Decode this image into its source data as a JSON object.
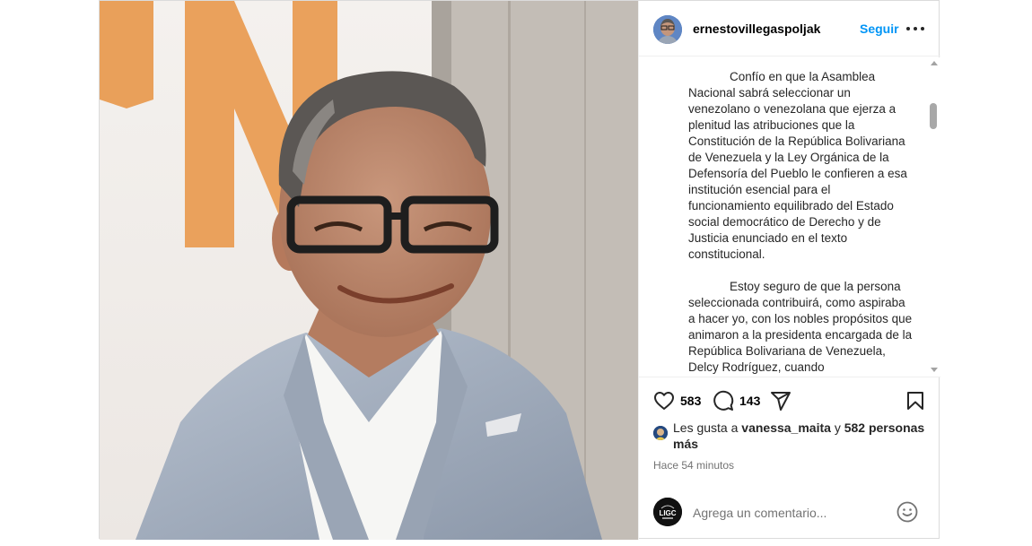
{
  "post": {
    "username": "ernestovillegaspoljak",
    "follow_label": "Seguir",
    "caption_paragraphs": [
      "Confío en que la Asamblea Nacional sabrá seleccionar un venezolano o venezolana que ejerza a plenitud las atribuciones que la Constitución de la República Bolivariana de Venezuela y la Ley Orgánica de la Defensoría del Pueblo le confieren a esa institución esencial para el funcionamiento equilibrado del Estado social democrático de Derecho y de Justicia enunciado en el texto constitucional.",
      "Estoy seguro de que la persona seleccionada contribuirá, como aspiraba a hacer yo, con los nobles propósitos que animaron a la presidenta encargada de la República Bolivariana de Venezuela, Delcy Rodríguez, cuando"
    ],
    "likes_count": "583",
    "comments_count": "143",
    "likes_prefix": "Les gusta a",
    "liked_by_user": "vanessa_maita",
    "likes_joiner": "y",
    "likes_others": "582 personas más",
    "timestamp": "Hace 54 minutos",
    "comment_placeholder": "Agrega un comentario...",
    "commenter_avatar_text": "LIGC"
  },
  "icons": {
    "like": "heart-icon",
    "comment": "comment-bubble-icon",
    "share": "send-icon",
    "save": "bookmark-icon",
    "more": "more-options-icon",
    "emoji": "emoji-icon"
  },
  "colors": {
    "accent": "#0095f6",
    "text": "#262626",
    "muted": "#737373",
    "divider": "#efefef"
  }
}
